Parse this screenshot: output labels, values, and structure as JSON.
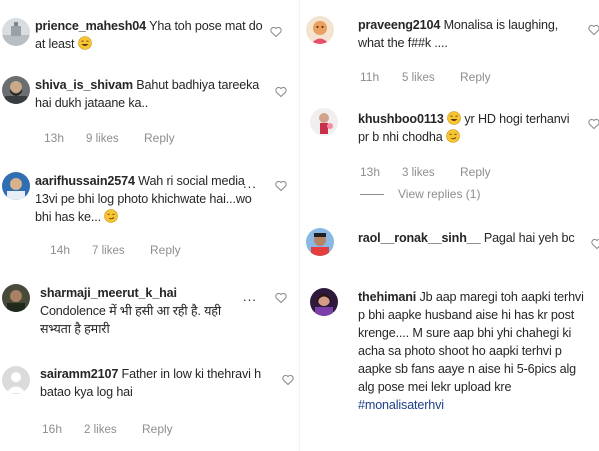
{
  "comments_left": [
    {
      "username": "prience_mahesh04",
      "text": "Yha toh pose mat do at least",
      "emoji": "laugh",
      "avatar": "avatar-landscape-grey"
    },
    {
      "username": "shiva_is_shivam",
      "text": "Bahut badhiya tareeka hai dukh jataane ka..",
      "time": "13h",
      "likes": "9 likes",
      "reply": "Reply",
      "avatar": "avatar-person-beard"
    },
    {
      "username": "aarifhussain2574",
      "text": "Wah ri social media 13vi pe bhi log photo khichwate hai...wo bhi has ke...",
      "emoji": "smirk",
      "time": "14h",
      "likes": "7 likes",
      "reply": "Reply",
      "more": "...",
      "avatar": "avatar-person-blue"
    },
    {
      "username": "sharmaji_meerut_k_hai",
      "text": "Condolence में भी हसी आ रही है. यही सभ्यता है हमारी",
      "more": "...",
      "avatar": "avatar-person-dark"
    },
    {
      "username": "sairamm2107",
      "text": "Father in low ki thehravi h batao kya log hai",
      "time": "16h",
      "likes": "2 likes",
      "reply": "Reply",
      "avatar": "avatar-default-grey"
    }
  ],
  "comments_right": [
    {
      "username": "praveeng2104",
      "text": "Monalisa is laughing, what the f##k ....",
      "time": "11h",
      "likes": "5 likes",
      "reply": "Reply",
      "avatar": "avatar-person-cartoon"
    },
    {
      "username": "khushboo0113",
      "text": "yr HD hogi terhanvi pr b nhi chodha",
      "emoji": "laugh",
      "emoji2": "smirk",
      "time": "13h",
      "likes": "3 likes",
      "reply": "Reply",
      "view_replies": "View replies (1)",
      "avatar": "avatar-person-flower"
    },
    {
      "username": "raol__ronak__sinh__",
      "text": "Pagal hai yeh bc",
      "avatar": "avatar-person-blue"
    },
    {
      "username": "thehimani",
      "text": "Jb aap maregi toh aapki terhvi p bhi aapke husband aise hi has kr post krenge.... M sure aap bhi yhi chahegi ki acha sa photo shoot ho aapki terhvi p aapke sb fans aaye n aise hi 5-6pics alg alg pose mei lekr upload kre",
      "hashtag": "#monalisaterhvi",
      "avatar": "avatar-person-purple"
    }
  ],
  "icons": {
    "heart": "heart-outline-icon",
    "more": "more-options-icon"
  },
  "colors": {
    "text": "#262626",
    "meta": "#8e8e8e",
    "hashtag": "#1d3f88"
  }
}
